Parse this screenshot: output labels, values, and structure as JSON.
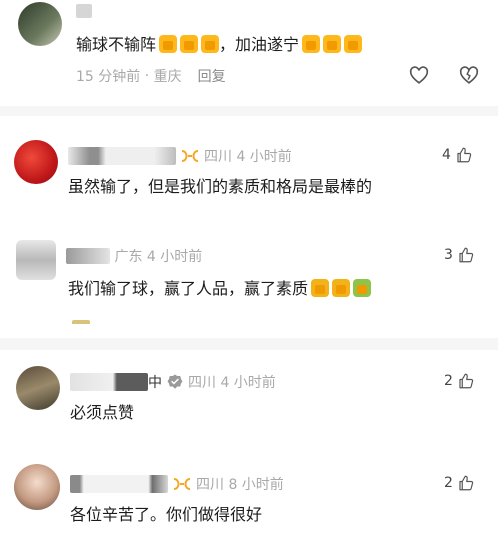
{
  "comments": [
    {
      "name": "",
      "text": "输球不输阵",
      "text2": "，加油遂宁",
      "time": "15 分钟前",
      "location": "重庆",
      "reply_label": "回复"
    },
    {
      "name": "",
      "location": "四川",
      "time": "4 小时前",
      "text": "虽然输了，但是我们的素质和格局是最棒的",
      "likes": "4"
    },
    {
      "name": "",
      "location": "广东",
      "time": "4 小时前",
      "text": "我们输了球，赢了人品，赢了素质",
      "likes": "3"
    },
    {
      "name": "中",
      "location": "四川",
      "time": "4 小时前",
      "text": "必须点赞",
      "likes": "2"
    },
    {
      "name": "",
      "location": "四川",
      "time": "8 小时前",
      "text": "各位辛苦了。你们做得很好",
      "likes": "2"
    }
  ],
  "icons": {
    "like": "heart-icon",
    "dislike": "broken-heart-icon",
    "thumb": "thumb-up-icon",
    "badge": "bow-badge-icon",
    "verified": "verified-check-icon",
    "emoji": "thumbs-up-emoji"
  },
  "colors": {
    "accent_orange": "#f5a623",
    "meta_gray": "#a9a9a9",
    "text": "#1c1c1c"
  }
}
